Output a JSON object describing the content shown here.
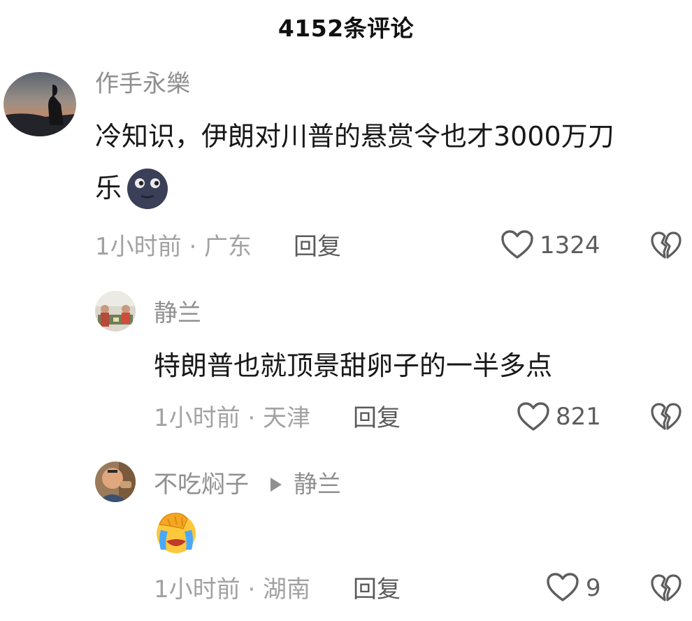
{
  "header": {
    "title": "4152条评论"
  },
  "comments": [
    {
      "username": "作手永樂",
      "text_line1": "冷知识，伊朗对川普的悬赏令也才3000万刀",
      "text_line2": "乐",
      "emoji": "moon-face-emoji",
      "time_loc": "1小时前 · 广东",
      "reply_label": "回复",
      "likes": "1324"
    },
    {
      "username": "静兰",
      "text_line1": "特朗普也就顶景甜卵子的一半多点",
      "time_loc": "1小时前 · 天津",
      "reply_label": "回复",
      "likes": "821"
    },
    {
      "username": "不吃焖子",
      "reply_to": "静兰",
      "emoji": "facepalm-crying-emoji",
      "time_loc": "1小时前 · 湖南",
      "reply_label": "回复",
      "likes": "9"
    }
  ],
  "colors": {
    "username": "#8f8f8f",
    "meta": "#a2a2a2",
    "text": "#181818",
    "icon": "#5d5d5d"
  }
}
